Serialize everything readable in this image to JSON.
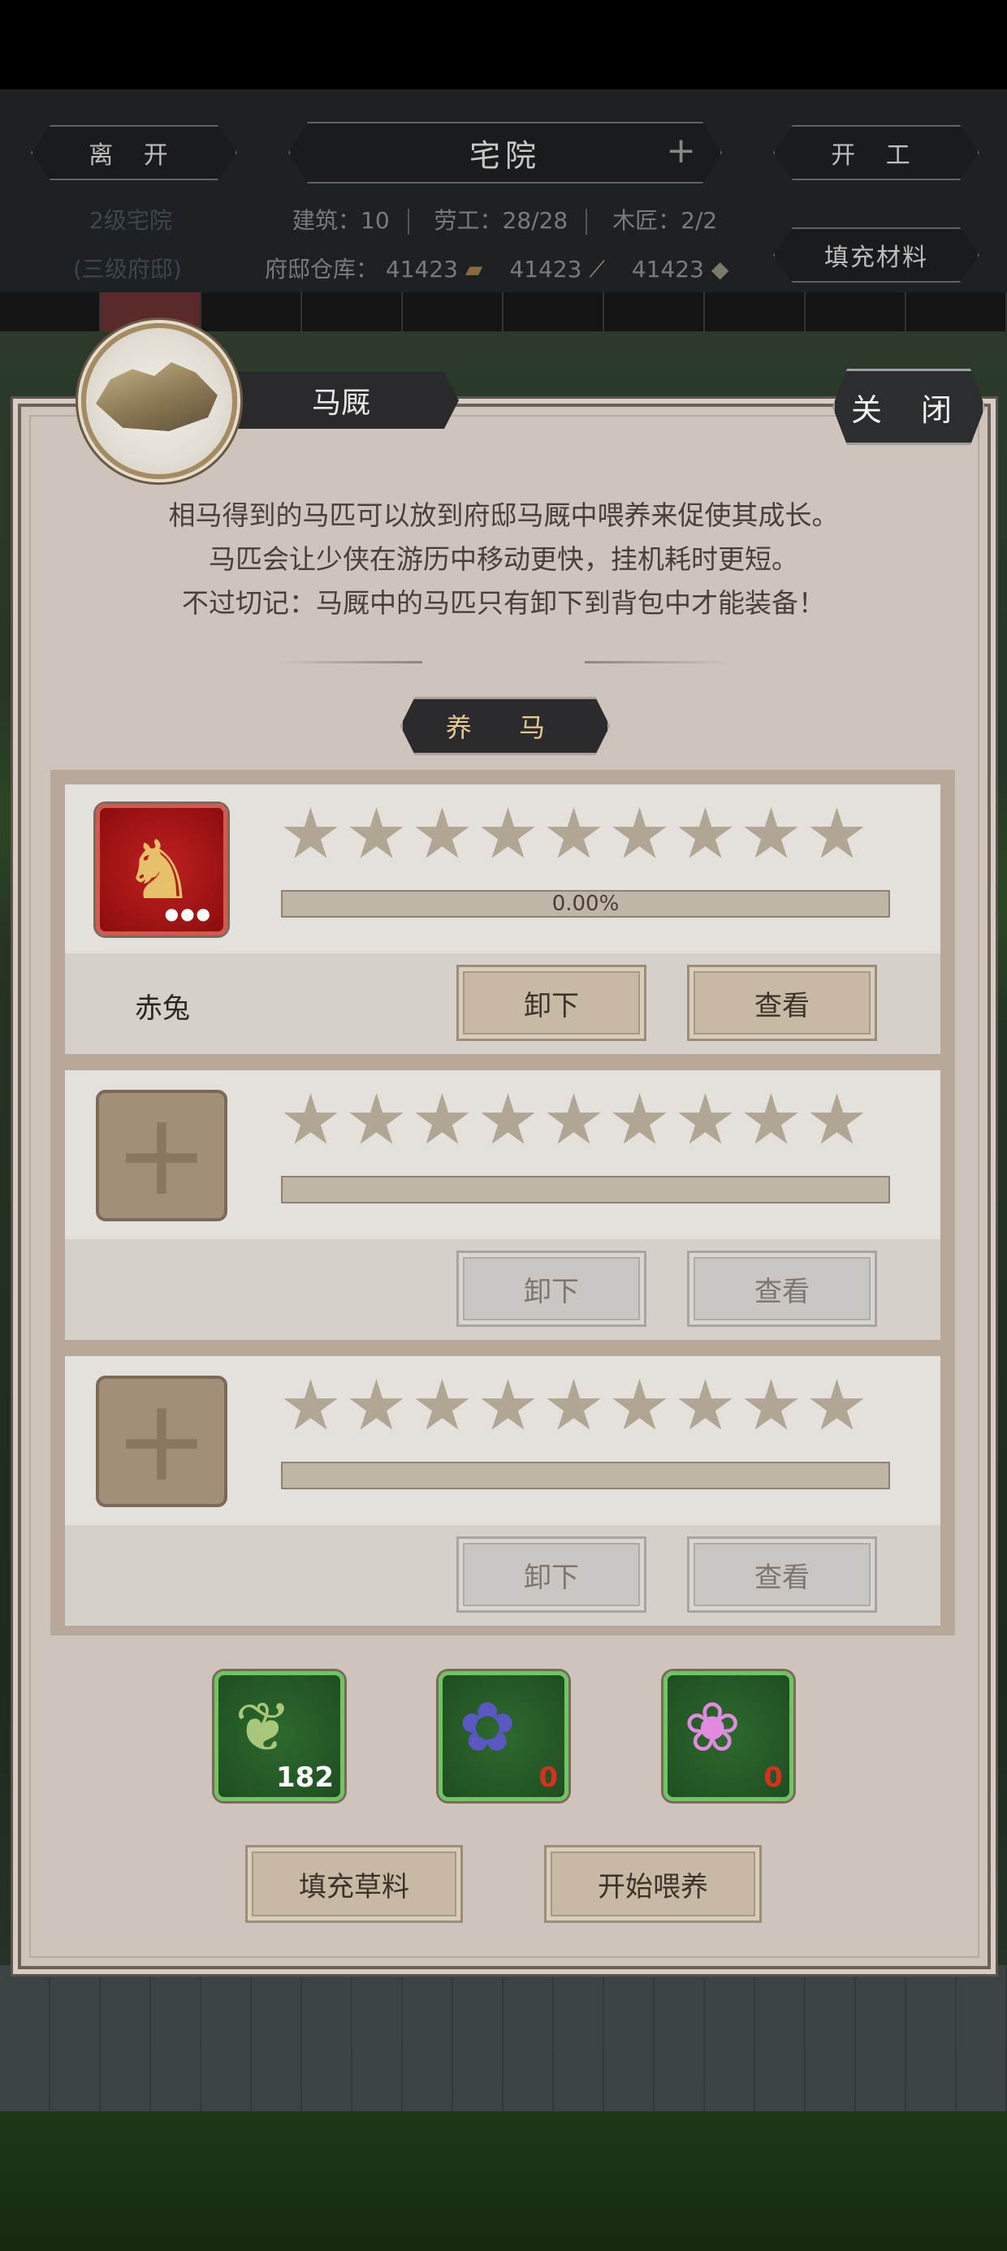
{
  "header": {
    "leave_label": "离 开",
    "title": "宅院",
    "start_work_label": "开 工",
    "fill_materials_label": "填充材料",
    "level_text": "2级宅院",
    "next_level_text": "(三级府邸)",
    "buildings": "建筑：10",
    "laborers": "劳工：28/28",
    "carpenters": "木匠：2/2",
    "warehouse_label": "府邸仓库：",
    "warehouse_values": [
      "41423",
      "41423",
      "41423"
    ]
  },
  "panel": {
    "title": "马厩",
    "close_label": "关 闭",
    "description": [
      "相马得到的马匹可以放到府邸马厩中喂养来促使其成长。",
      "马匹会让少侠在游历中移动更快，挂机耗时更短。",
      "不过切记：马厩中的马匹只有卸下到背包中才能装备！"
    ],
    "section_label": "养 马"
  },
  "slots": [
    {
      "horse_name": "赤兔",
      "progress_text": "0.00%",
      "unload_label": "卸下",
      "view_label": "查看",
      "icon": "red-horse-icon",
      "star_rating": 0
    },
    {
      "horse_name": "",
      "progress_text": "",
      "unload_label": "卸下",
      "view_label": "查看",
      "icon": "plus-icon"
    },
    {
      "horse_name": "",
      "progress_text": "",
      "unload_label": "卸下",
      "view_label": "查看",
      "icon": "plus-icon"
    }
  ],
  "feed": [
    {
      "icon": "grass-icon",
      "count": "182"
    },
    {
      "icon": "blue-flower-icon",
      "count": "0"
    },
    {
      "icon": "purple-flower-icon",
      "count": "0"
    }
  ],
  "actions": {
    "fill_fodder_label": "填充草料",
    "start_feeding_label": "开始喂养"
  }
}
